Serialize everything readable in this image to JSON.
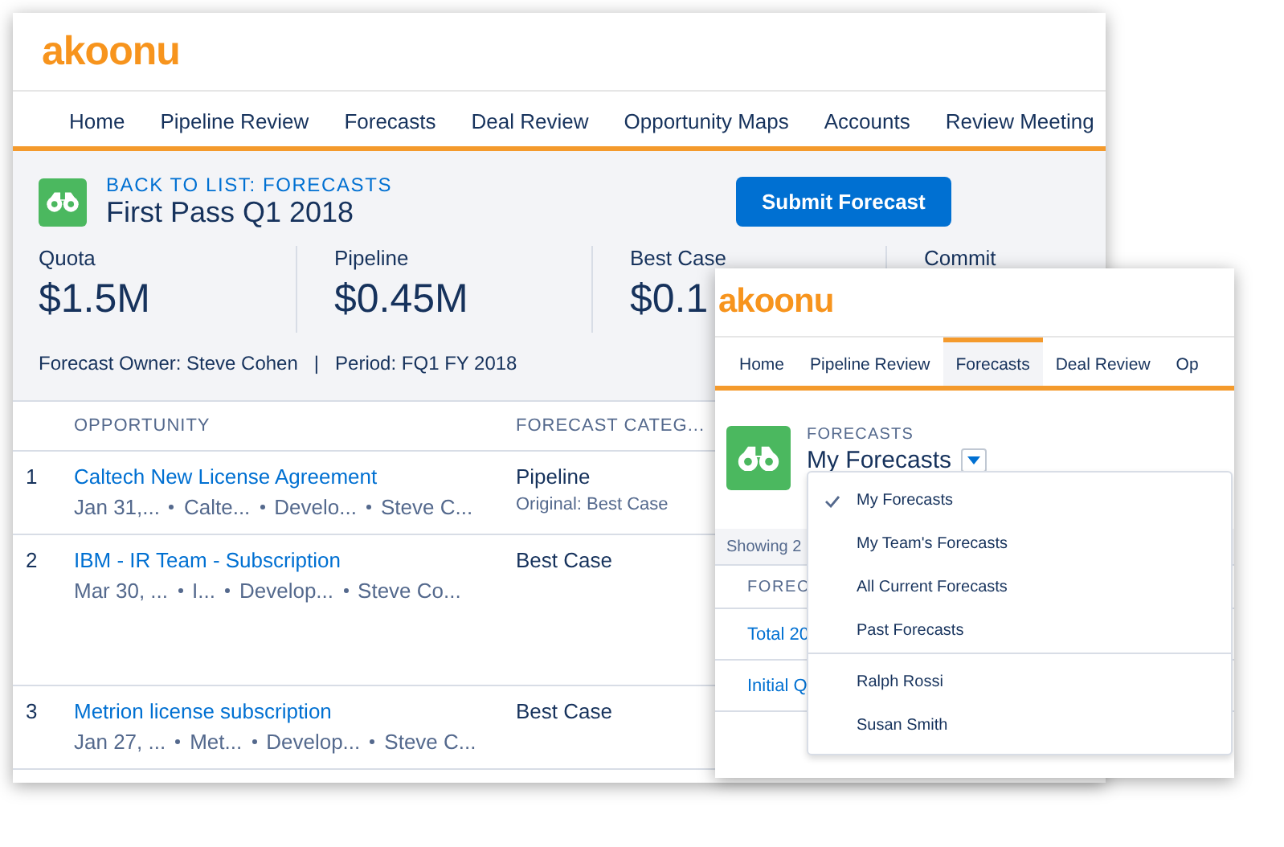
{
  "back_window": {
    "logo": "akoonu",
    "nav": [
      "Home",
      "Pipeline Review",
      "Forecasts",
      "Deal Review",
      "Opportunity Maps",
      "Accounts",
      "Review Meeting"
    ],
    "header": {
      "back_link": "BACK TO LIST: FORECASTS",
      "title": "First Pass Q1 2018",
      "submit_button": "Submit Forecast",
      "stats": [
        {
          "label": "Quota",
          "value": "$1.5M"
        },
        {
          "label": "Pipeline",
          "value": "$0.45M"
        },
        {
          "label": "Best Case",
          "value": "$0.1"
        },
        {
          "label": "Commit"
        }
      ],
      "owner": "Forecast Owner: Steve Cohen",
      "separator": "|",
      "period": "Period: FQ1 FY 2018"
    },
    "table": {
      "columns": [
        "OPPORTUNITY",
        "FORECAST CATEG..."
      ],
      "rows": [
        {
          "number": "1",
          "name": "Caltech New License Agreement",
          "meta": [
            "Jan 31,...",
            "Calte...",
            "Develo...",
            "Steve C..."
          ],
          "category": "Pipeline",
          "original": "Original: Best Case"
        },
        {
          "number": "2",
          "name": "IBM - IR Team - Subscription",
          "meta": [
            "Mar 30, ...",
            "I...",
            "Develop...",
            "Steve Co..."
          ],
          "category": "Best Case"
        },
        {
          "number": "3",
          "name": "Metrion license subscription",
          "meta": [
            "Jan 27, ...",
            "Met...",
            "Develop...",
            "Steve C..."
          ],
          "category": "Best Case"
        }
      ]
    }
  },
  "front_window": {
    "logo": "akoonu",
    "nav": [
      {
        "label": "Home",
        "selected": false
      },
      {
        "label": "Pipeline Review",
        "selected": false
      },
      {
        "label": "Forecasts",
        "selected": true
      },
      {
        "label": "Deal Review",
        "selected": false
      },
      {
        "label": "Op",
        "selected": false
      }
    ],
    "header": {
      "eyebrow": "FORECASTS",
      "list_view": "My Forecasts"
    },
    "showing": "Showing 2",
    "table": {
      "column": "FOREC",
      "rows": [
        "Total 20",
        "Initial Q"
      ]
    },
    "dropdown": {
      "sections": [
        {
          "items": [
            {
              "label": "My Forecasts",
              "selected": true
            },
            {
              "label": "My Team's Forecasts",
              "selected": false
            },
            {
              "label": "All Current Forecasts",
              "selected": false
            },
            {
              "label": "Past Forecasts",
              "selected": false
            }
          ]
        },
        {
          "items": [
            {
              "label": "Ralph Rossi",
              "selected": false
            },
            {
              "label": "Susan Smith",
              "selected": false
            }
          ]
        }
      ]
    }
  }
}
